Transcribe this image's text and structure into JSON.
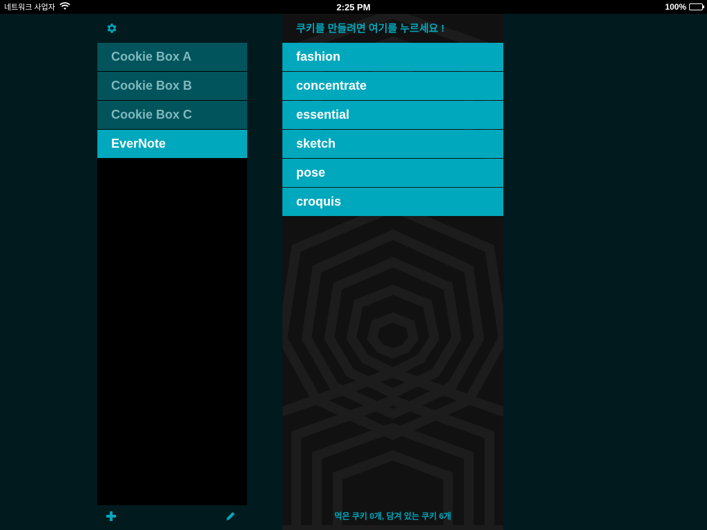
{
  "status_bar": {
    "carrier": "네트워크 사업자",
    "time": "2:25 PM",
    "battery": "100%"
  },
  "left_panel": {
    "boxes": [
      {
        "label": "Cookie Box A",
        "active": false
      },
      {
        "label": "Cookie Box B",
        "active": false
      },
      {
        "label": "Cookie Box C",
        "active": false
      },
      {
        "label": "EverNote",
        "active": true
      }
    ]
  },
  "right_panel": {
    "make_cookie_prompt": "쿠키를 만들려면 여기를 누르세요 !",
    "cookies": [
      "fashion",
      "concentrate",
      "essential",
      "sketch",
      "pose",
      "croquis"
    ],
    "footer_count": "먹은 쿠키 0개, 담겨 있는 쿠키 6개"
  },
  "colors": {
    "accent": "#00a8bd",
    "inactive_item": "#02545c",
    "background": "#001a1d"
  },
  "icons": {
    "settings": "gear-icon",
    "add": "plus-icon",
    "edit": "pencil-icon",
    "wifi": "wifi-icon",
    "battery": "battery-icon"
  }
}
